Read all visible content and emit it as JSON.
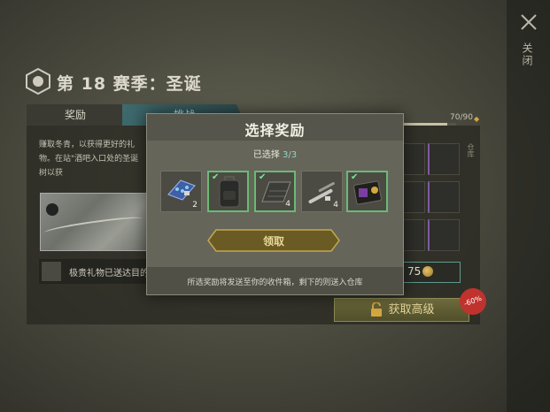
{
  "window": {
    "close_label": "关闭"
  },
  "season": {
    "title": "第 18 赛季：圣诞"
  },
  "tabs": [
    {
      "label": "奖励"
    },
    {
      "label": "挑战"
    }
  ],
  "progress": {
    "text": "70/90",
    "value": 70,
    "max": 90
  },
  "left_panel": {
    "earn_text": "赚取冬青，以获得更好的礼物。在站\"酒吧入口处的圣诞树以获",
    "gift_text": "极贵礼物已送达目的"
  },
  "right_panel": {
    "column_tag": "仓库",
    "currency_value": "75"
  },
  "premium": {
    "label": "获取高级",
    "discount": "-60%"
  },
  "modal": {
    "title": "选择奖励",
    "selected_prefix": "已选择",
    "selected_count": "3/3",
    "items": [
      {
        "icon": "medkit-icon",
        "count": "2",
        "picked": false
      },
      {
        "icon": "backpack-icon",
        "count": "",
        "picked": true
      },
      {
        "icon": "armor-plate-icon",
        "count": "4",
        "picked": true
      },
      {
        "icon": "weapon-parts-icon",
        "count": "4",
        "picked": false
      },
      {
        "icon": "keycard-icon",
        "count": "",
        "picked": true
      }
    ],
    "claim_label": "领取",
    "footer_text": "所选奖励将发送至你的收件箱，剩下的则送入仓库"
  },
  "colors": {
    "selected_green": "#6aba76",
    "accent_teal": "#8fd6c8",
    "gold": "#e9d898",
    "discount_red": "#c0322d"
  }
}
